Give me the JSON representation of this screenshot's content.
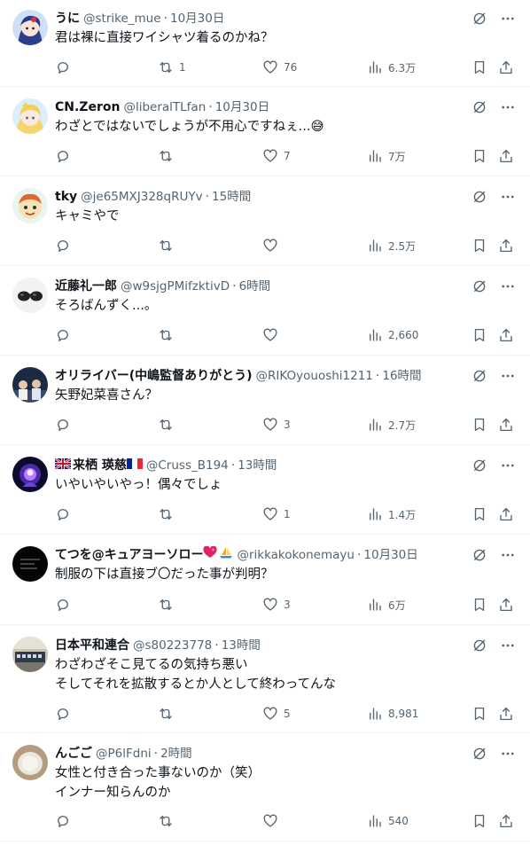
{
  "colors": {
    "text": "#0f1419",
    "secondary": "#536471",
    "divider": "#eff3f4"
  },
  "icons": {
    "grok": "grok-icon",
    "more": "more-icon",
    "reply": "reply-icon",
    "retweet": "retweet-icon",
    "like": "like-icon",
    "views": "views-icon",
    "bookmark": "bookmark-icon",
    "share": "share-icon"
  },
  "posts": [
    {
      "name": "うに",
      "handle": "@strike_mue",
      "sep": "·",
      "time": "10月30日",
      "lines": [
        "君は裸に直接ワイシャツ着るのかね？"
      ],
      "replies": "",
      "retweets": "1",
      "likes": "76",
      "views": "6.3万"
    },
    {
      "name": "CN.Zeron",
      "handle": "@liberalTLfan",
      "sep": "·",
      "time": "10月30日",
      "lines": [
        "わざとではないでしょうが不用心ですねぇ...😅"
      ],
      "replies": "",
      "retweets": "",
      "likes": "7",
      "views": "7万"
    },
    {
      "name": "tky",
      "handle": "@je65MXJ328qRUYv",
      "sep": "·",
      "time": "15時間",
      "lines": [
        "キャミやで"
      ],
      "replies": "",
      "retweets": "",
      "likes": "",
      "views": "2.5万"
    },
    {
      "name": "近藤礼一郎",
      "handle": "@w9sjgPMifzktivD",
      "sep": "·",
      "time": "6時間",
      "lines": [
        "そろばんずく...。"
      ],
      "replies": "",
      "retweets": "",
      "likes": "",
      "views": "2,660"
    },
    {
      "name": "オリライバー(中嶋監督ありがとう)",
      "handle": "@RIKOyouoshi1211",
      "sep": "·",
      "time": "16時間",
      "lines": [
        "矢野妃菜喜さん？"
      ],
      "replies": "",
      "retweets": "",
      "likes": "3",
      "views": "2.7万"
    },
    {
      "name": "来栖 瑛慈",
      "handle": "@Cruss_B194",
      "sep": "·",
      "time": "13時間",
      "lines": [
        "いやいやいやっ！偶々でしょ"
      ],
      "replies": "",
      "retweets": "",
      "likes": "1",
      "views": "1.4万"
    },
    {
      "name": "てつを@キュアヨーソロー",
      "handle": "@rikkakokonemayu",
      "sep": "·",
      "time": "10月30日",
      "lines": [
        "制服の下は直接ブ〇だった事が判明？"
      ],
      "replies": "",
      "retweets": "",
      "likes": "3",
      "views": "6万"
    },
    {
      "name": "日本平和連合",
      "handle": "@s80223778",
      "sep": "·",
      "time": "13時間",
      "lines": [
        "わざわざそこ見てるの気持ち悪い",
        "そしてそれを拡散するとか人として終わってんな"
      ],
      "replies": "",
      "retweets": "",
      "likes": "5",
      "views": "8,981"
    },
    {
      "name": "んごご",
      "handle": "@P6lFdni",
      "sep": "·",
      "time": "2時間",
      "lines": [
        "女性と付き合った事ないのか（笑）",
        "インナー知らんのか"
      ],
      "replies": "",
      "retweets": "",
      "likes": "",
      "views": "540"
    }
  ]
}
